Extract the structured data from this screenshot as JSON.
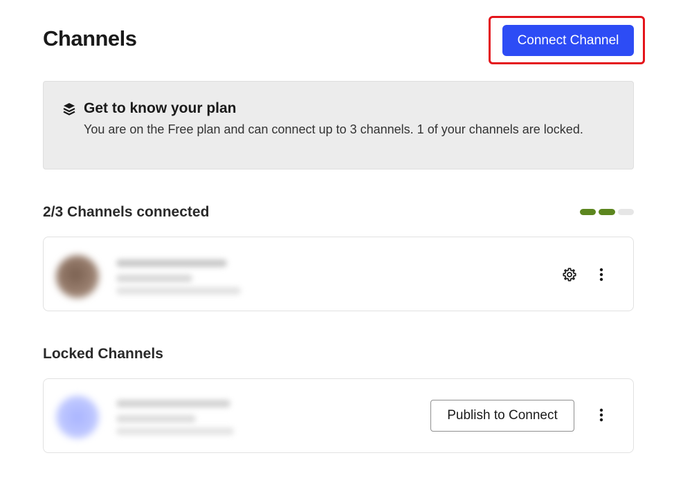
{
  "header": {
    "title": "Channels",
    "connect_label": "Connect Channel",
    "highlight_color": "#e4141b",
    "button_color": "#2d4cf5"
  },
  "plan": {
    "icon": "layers-icon",
    "title": "Get to know your plan",
    "description": "You are on the Free plan and can connect up to 3 channels. 1 of your channels are locked."
  },
  "connected": {
    "heading": "2/3 Channels connected",
    "progress": {
      "filled": 2,
      "total": 3,
      "color": "#5c861f"
    },
    "channels": [
      {
        "avatar": "blurred-avatar",
        "settings_icon": "gear-icon",
        "menu_icon": "more-vertical-icon"
      }
    ]
  },
  "locked": {
    "heading": "Locked Channels",
    "channels": [
      {
        "avatar": "blurred-avatar",
        "action_label": "Publish to Connect",
        "menu_icon": "more-vertical-icon"
      }
    ]
  }
}
